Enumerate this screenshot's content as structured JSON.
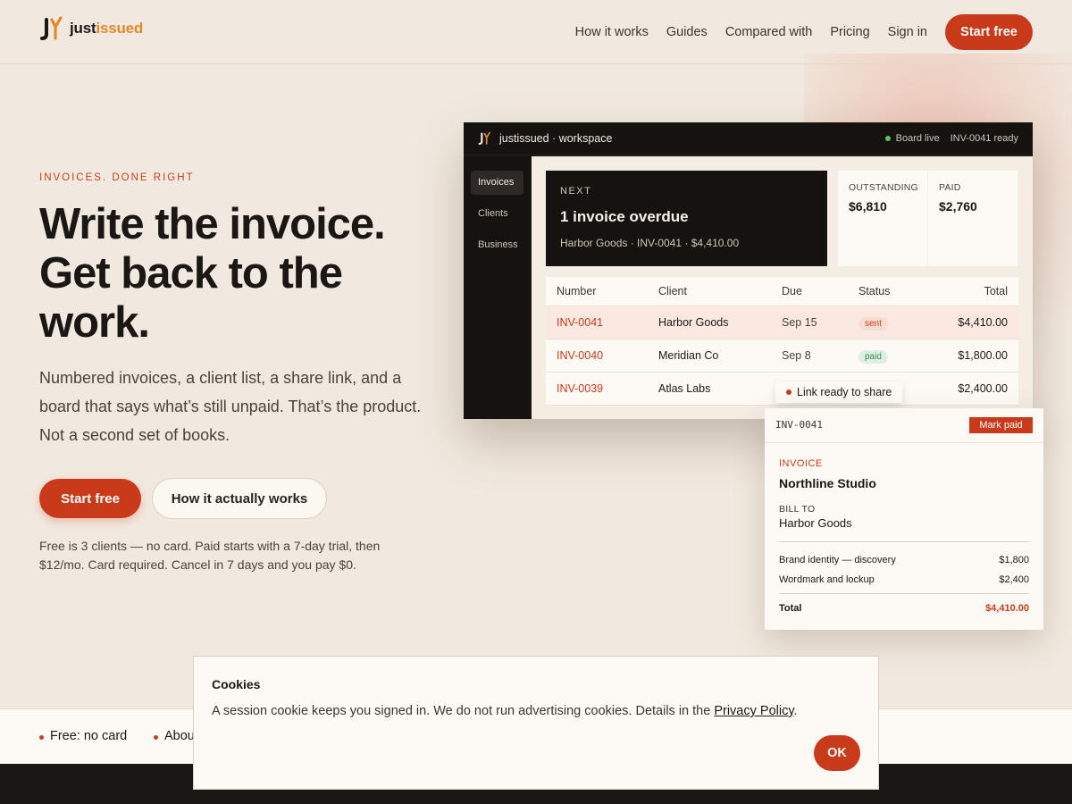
{
  "header": {
    "brand_a": "just",
    "brand_b": "issued",
    "nav": [
      "How it works",
      "Guides",
      "Compared with",
      "Pricing",
      "Sign in"
    ],
    "cta": "Start free"
  },
  "hero": {
    "eyebrow": "INVOICES. DONE RIGHT",
    "headline": "Write the invoice. Get back to the work.",
    "sub": "Numbered invoices, a client list, a share link, and a board that says what’s still unpaid. That’s the product. Not a second set of books.",
    "cta_primary": "Start free",
    "cta_secondary": "How it actually works",
    "fine_print": "Free is 3 clients — no card. Paid starts with a 7-day trial, then $12/mo. Card required. Cancel in 7 days and you pay $0."
  },
  "app": {
    "title": "justissued · workspace",
    "status_live": "Board live",
    "status_ready": "INV-0041 ready",
    "sidebar": [
      "Invoices",
      "Clients",
      "Business"
    ],
    "next": {
      "label": "NEXT",
      "title": "1 invoice overdue",
      "detail": "Harbor Goods · INV-0041 · $4,410.00"
    },
    "stats": [
      {
        "label": "OUTSTANDING",
        "value": "$6,810"
      },
      {
        "label": "PAID",
        "value": "$2,760"
      }
    ],
    "table": {
      "headers": [
        "Number",
        "Client",
        "Due",
        "Status",
        "Total"
      ],
      "rows": [
        {
          "number": "INV-0041",
          "client": "Harbor Goods",
          "due": "Sep 15",
          "status": "sent",
          "total": "$4,410.00"
        },
        {
          "number": "INV-0040",
          "client": "Meridian Co",
          "due": "Sep 8",
          "status": "paid",
          "total": "$1,800.00"
        },
        {
          "number": "INV-0039",
          "client": "Atlas Labs",
          "due": "",
          "status": "",
          "total": "$2,400.00"
        }
      ]
    },
    "toast": "Link ready to share"
  },
  "invoice": {
    "number": "INV-0041",
    "mark_paid": "Mark paid",
    "kicker": "INVOICE",
    "studio": "Northline Studio",
    "bill_to_label": "BILL TO",
    "bill_to": "Harbor Goods",
    "lines": [
      {
        "desc": "Brand identity — discovery",
        "amount": "$1,800"
      },
      {
        "desc": "Wordmark and lockup",
        "amount": "$2,400"
      }
    ],
    "total_label": "Total",
    "total": "$4,410.00"
  },
  "strip": {
    "chips": [
      "Free: no card",
      "Abou"
    ]
  },
  "cookie": {
    "title": "Cookies",
    "text": "A session cookie keeps you signed in. We do not run advertising cookies. Details in the ",
    "link": "Privacy Policy",
    "after": ".",
    "ok": "OK"
  },
  "colors": {
    "accent": "#c83a1a",
    "brand_orange": "#e08a2a",
    "background": "#f1e9df",
    "dark": "#16120f"
  },
  "icons": [
    "logo-mark-icon",
    "status-dot-icon"
  ]
}
